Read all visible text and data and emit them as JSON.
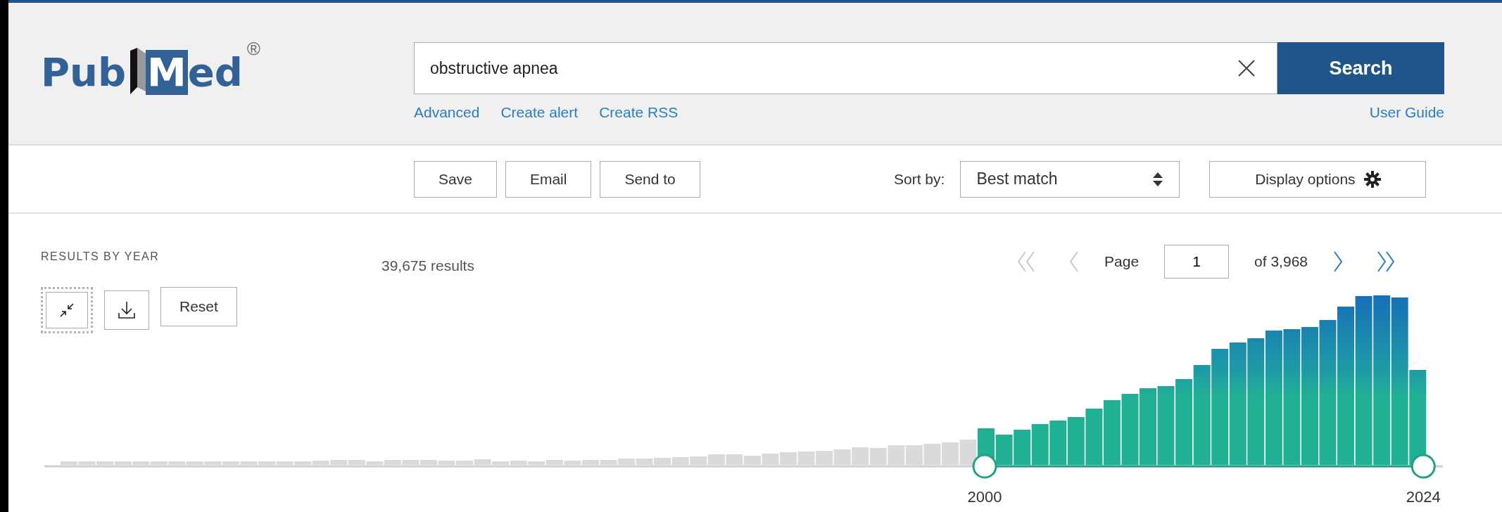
{
  "header": {
    "logo": {
      "left": "Pub",
      "right": "Med",
      "mark": "®"
    },
    "search": {
      "value": "obstructive apnea",
      "button": "Search"
    },
    "links": [
      {
        "label": "Advanced"
      },
      {
        "label": "Create alert"
      },
      {
        "label": "Create RSS"
      }
    ],
    "user_guide": "User Guide"
  },
  "toolbar": {
    "buttons": [
      "Save",
      "Email",
      "Send to"
    ],
    "sort_label": "Sort by:",
    "sort_value": "Best match",
    "display_options": "Display options"
  },
  "timeline": {
    "title": "RESULTS BY YEAR",
    "collapse": {
      "focused": true
    },
    "reset": "Reset",
    "year_range": {
      "start": "2000",
      "end": "2024"
    }
  },
  "results_count": "39,675 results",
  "pagination": {
    "first": {
      "disabled": true
    },
    "previous": {
      "disabled": true
    },
    "label": "Page",
    "value": "1",
    "total": "of 3,968",
    "next": {
      "disabled": false
    },
    "last": {
      "disabled": false
    }
  }
}
